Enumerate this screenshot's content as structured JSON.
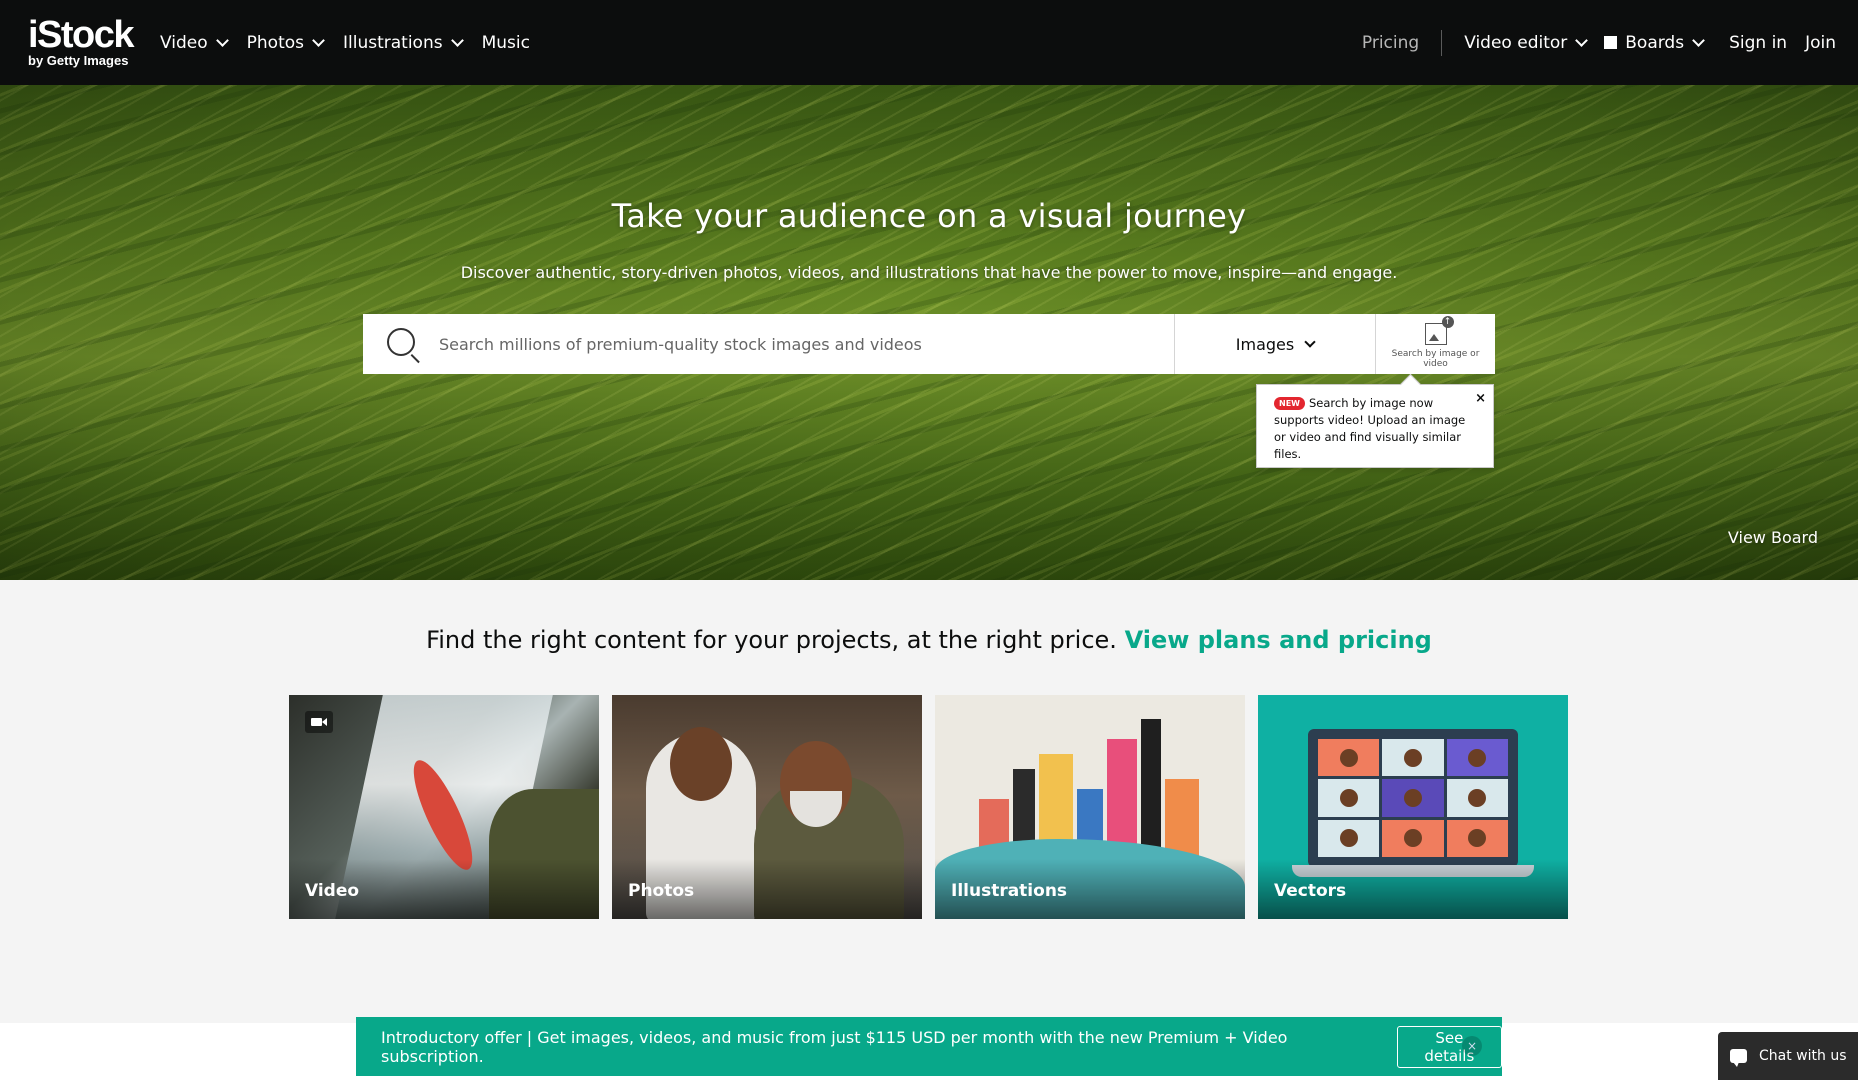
{
  "header": {
    "logo_main": "iStock",
    "logo_sub": "by Getty Images",
    "nav_left": [
      {
        "label": "Video",
        "dropdown": true
      },
      {
        "label": "Photos",
        "dropdown": true
      },
      {
        "label": "Illustrations",
        "dropdown": true
      },
      {
        "label": "Music",
        "dropdown": false
      }
    ],
    "pricing": "Pricing",
    "video_editor": "Video editor",
    "boards": "Boards",
    "sign_in": "Sign in",
    "join": "Join"
  },
  "hero": {
    "title": "Take your audience on a visual journey",
    "subtitle": "Discover authentic, story-driven photos, videos, and illustrations that have the power to move, inspire—and engage.",
    "search_placeholder": "Search millions of premium-quality stock images and videos",
    "search_type": "Images",
    "search_by_image_label": "Search by image or video",
    "tooltip_badge": "NEW",
    "tooltip_text": "Search by image now supports video! Upload an image or video and find visually similar files.",
    "tooltip_close": "×",
    "view_board": "View Board"
  },
  "section": {
    "tagline": "Find the right content for your projects, at the right price.",
    "tagline_link": "View plans and pricing",
    "tiles": [
      {
        "label": "Video"
      },
      {
        "label": "Photos"
      },
      {
        "label": "Illustrations"
      },
      {
        "label": "Vectors"
      }
    ]
  },
  "promo": {
    "text": "Introductory offer | Get images, videos, and music from just $115 USD per month with the new Premium + Video subscription.",
    "button": "See details",
    "close": "×"
  },
  "chat": {
    "label": "Chat with us"
  },
  "colors": {
    "header_bg": "#0c0d0d",
    "accent_teal": "#08a88a",
    "new_badge": "#e3262f",
    "vectors_bg": "#0fb0a3"
  },
  "icons": {
    "search": "search-icon",
    "search_by_image": "image-upload-icon",
    "video_badge": "video-camera-icon",
    "boards": "boards-icon",
    "chat": "chat-bubble-icon",
    "close": "close-icon"
  }
}
